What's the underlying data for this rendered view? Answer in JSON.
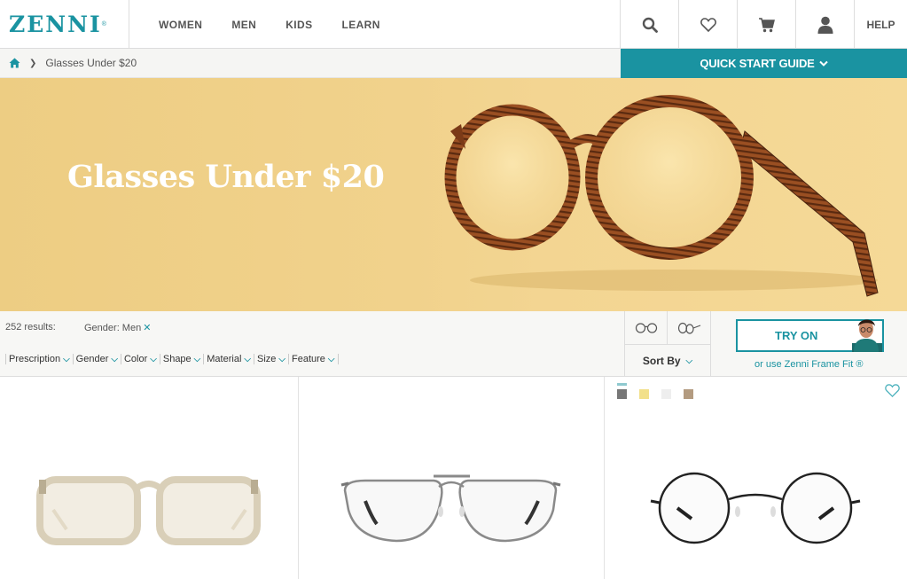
{
  "header": {
    "logo_text": "ZENNI",
    "logo_mark": "®",
    "nav": [
      "WOMEN",
      "MEN",
      "KIDS",
      "LEARN"
    ],
    "help_label": "HELP",
    "icons": [
      "search-icon",
      "heart-icon",
      "cart-icon",
      "account-icon"
    ]
  },
  "breadcrumb": {
    "home_icon": "home-icon",
    "current": "Glasses Under $20"
  },
  "quick_start": {
    "label": "QUICK START GUIDE"
  },
  "hero": {
    "title": "Glasses Under $20"
  },
  "filter_bar": {
    "results": "252 results:",
    "active_filter": "Gender: Men",
    "remove_icon": "✕",
    "filters": [
      "Prescription",
      "Gender",
      "Color",
      "Shape",
      "Material",
      "Size",
      "Feature"
    ],
    "sort_label": "Sort By",
    "try_on_label": "TRY ON",
    "frame_fit": "or use Zenni Frame Fit ®"
  },
  "products": [
    {
      "name": "clear-square-glasses",
      "frame_color": "#d9cfb8"
    },
    {
      "name": "aviator-glasses",
      "frame_color": "#8a8a8a"
    },
    {
      "name": "round-wire-glasses",
      "frame_color": "#222222",
      "swatches": [
        "#777777",
        "#f2e08a",
        "#eeeeee",
        "#b39b80"
      ]
    }
  ],
  "colors": {
    "accent": "#1a93a1",
    "hero_bg": "#f1d28c"
  }
}
